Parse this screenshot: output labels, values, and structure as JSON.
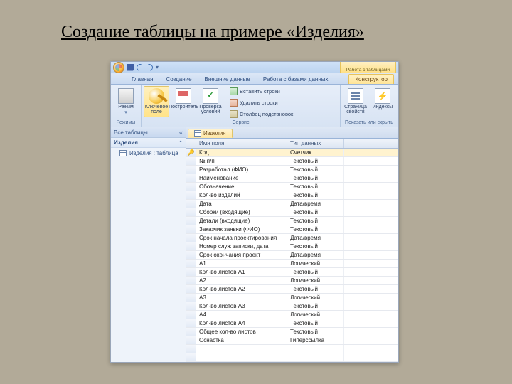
{
  "slide": {
    "title": "Создание таблицы на примере «Изделия»"
  },
  "titlebar": {
    "context_title": "Работа с таблицами"
  },
  "ribbon": {
    "tabs": [
      "Главная",
      "Создание",
      "Внешние данные",
      "Работа с базами данных"
    ],
    "context_tab": "Конструктор",
    "groups": {
      "views": {
        "label": "Режимы",
        "view_btn": "Режим"
      },
      "tools": {
        "label": "Сервис",
        "key_btn": "Ключевое\nполе",
        "builder_btn": "Построитель",
        "check_btn": "Проверка\nусловий",
        "insert": "Вставить строки",
        "delete": "Удалить строки",
        "lookup": "Столбец подстановок"
      },
      "showhide": {
        "label": "Показать или скрыть",
        "prop_btn": "Страница\nсвойств",
        "index_btn": "Индексы"
      }
    }
  },
  "nav": {
    "header": "Все таблицы",
    "group": "Изделия",
    "item": "Изделия : таблица"
  },
  "doc": {
    "tab": "Изделия",
    "col_field": "Имя поля",
    "col_type": "Тип данных",
    "fields": [
      {
        "name": "Код",
        "type": "Счетчик",
        "key": true
      },
      {
        "name": "№ п/п",
        "type": "Текстовый"
      },
      {
        "name": "Разработал (ФИО)",
        "type": "Текстовый"
      },
      {
        "name": "Наименование",
        "type": "Текстовый"
      },
      {
        "name": "Обозначение",
        "type": "Текстовый"
      },
      {
        "name": "Кол-во изделий",
        "type": "Текстовый"
      },
      {
        "name": "Дата",
        "type": "Дата/время"
      },
      {
        "name": "Сборки (входящие)",
        "type": "Текстовый"
      },
      {
        "name": "Детали (входящие)",
        "type": "Текстовый"
      },
      {
        "name": "Заказчик заявки (ФИО)",
        "type": "Текстовый"
      },
      {
        "name": "Срок начала проектирования",
        "type": "Дата/время"
      },
      {
        "name": "Номер служ записки, дата",
        "type": "Текстовый"
      },
      {
        "name": "Срок окончания проект",
        "type": "Дата/время"
      },
      {
        "name": "А1",
        "type": "Логический"
      },
      {
        "name": "Кол-во листов А1",
        "type": "Текстовый"
      },
      {
        "name": "А2",
        "type": "Логический"
      },
      {
        "name": "Кол-во листов А2",
        "type": "Текстовый"
      },
      {
        "name": "А3",
        "type": "Логический"
      },
      {
        "name": "Кол-во листов А3",
        "type": "Текстовый"
      },
      {
        "name": "А4",
        "type": "Логический"
      },
      {
        "name": "Кол-во листов А4",
        "type": "Текстовый"
      },
      {
        "name": "Общее кол-во листов",
        "type": "Текстовый"
      },
      {
        "name": "Оснастка",
        "type": "Гиперссылка"
      }
    ]
  }
}
